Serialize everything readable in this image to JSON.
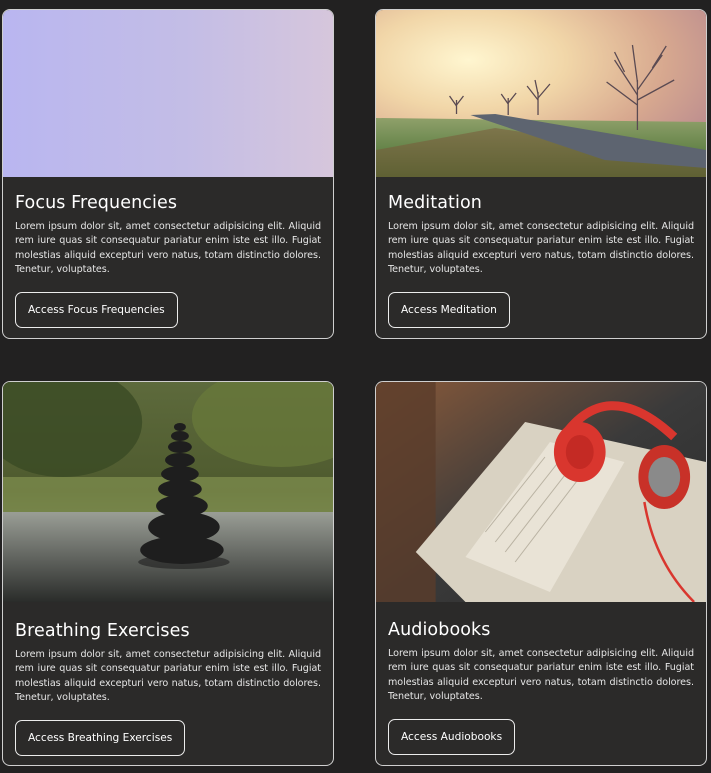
{
  "cards": [
    {
      "title": "Focus Frequencies",
      "description": "Lorem ipsum dolor sit, amet consectetur adipisicing elit. Aliquid rem iure quas sit consequatur pariatur enim iste est illo. Fugiat molestias aliquid excepturi vero natus, totam distinctio dolores. Tenetur, voluptates.",
      "button_label": "Access Focus Frequencies",
      "image": "sound-waveform-image"
    },
    {
      "title": "Meditation",
      "description": "Lorem ipsum dolor sit, amet consectetur adipisicing elit. Aliquid rem iure quas sit consequatur pariatur enim iste est illo. Fugiat molestias aliquid excepturi vero natus, totam distinctio dolores. Tenetur, voluptates.",
      "button_label": "Access Meditation",
      "image": "misty-road-trees-image"
    },
    {
      "title": "Breathing Exercises",
      "description": "Lorem ipsum dolor sit, amet consectetur adipisicing elit. Aliquid rem iure quas sit consequatur pariatur enim iste est illo. Fugiat molestias aliquid excepturi vero natus, totam distinctio dolores. Tenetur, voluptates.",
      "button_label": "Access Breathing Exercises",
      "image": "stacked-stones-water-image"
    },
    {
      "title": "Audiobooks",
      "description": "Lorem ipsum dolor sit, amet consectetur adipisicing elit. Aliquid rem iure quas sit consequatur pariatur enim iste est illo. Fugiat molestias aliquid excepturi vero natus, totam distinctio dolores. Tenetur, voluptates.",
      "button_label": "Access Audiobooks",
      "image": "headphones-on-book-image"
    }
  ],
  "colors": {
    "page_background": "#222121",
    "card_background": "#2b2a29",
    "card_border": "#cfcfcf",
    "text": "#ffffff"
  }
}
